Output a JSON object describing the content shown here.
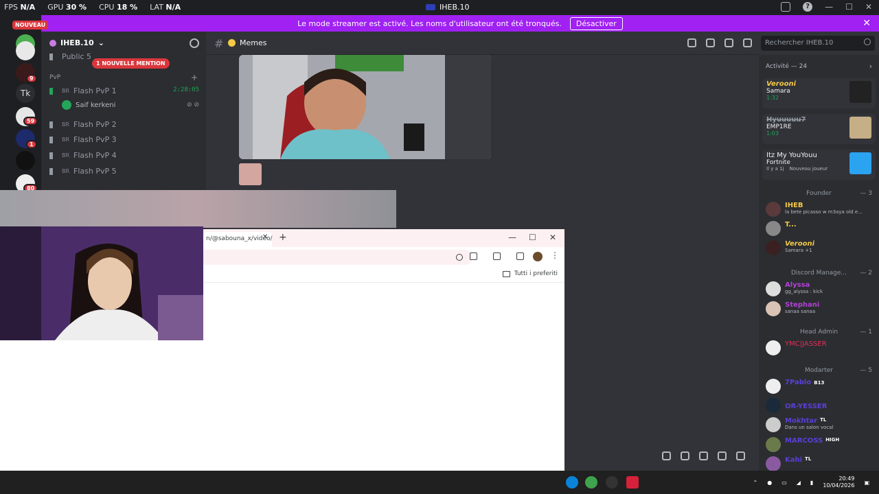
{
  "titlebar": {
    "fps_label": "FPS",
    "fps_value": "N/A",
    "gpu_label": "GPU",
    "gpu_value": "30 %",
    "cpu_label": "CPU",
    "cpu_value": "18 %",
    "lat_label": "LAT",
    "lat_value": "N/A",
    "app_title": "IHEB.10"
  },
  "banner": {
    "text": "Le mode streamer est activé. Les noms d'utilisateur ont été tronqués.",
    "button": "Désactiver"
  },
  "rail": {
    "new_badge": "NOUVEAU",
    "tk": "Tk",
    "badges": [
      "9",
      "59",
      "1",
      "80"
    ]
  },
  "sidebar": {
    "server_name": "IHEB.10",
    "mention_badge": "1 NOUVELLE MENTION",
    "top_channel": "Public 5",
    "category": "PvP",
    "channels": [
      {
        "tag": "BR",
        "name": "Flash PvP 1"
      },
      {
        "tag": "BR",
        "name": "Flash PvP 2"
      },
      {
        "tag": "BR",
        "name": "Flash PvP 3"
      },
      {
        "tag": "BR",
        "name": "Flash PvP 4"
      },
      {
        "tag": "BR",
        "name": "Flash PvP 5"
      }
    ],
    "timer": "2:28:05",
    "voice_user": "Saif kerkeni"
  },
  "channel": {
    "name": "Memes",
    "search_placeholder": "Rechercher IHEB.10"
  },
  "activity": {
    "title": "Activité — 24",
    "items": [
      {
        "name": "Verooni",
        "sub": "Samara",
        "time": "1:32"
      },
      {
        "name": "Hyuuuuu7",
        "sub": "EMP1RE",
        "time": "1:03"
      },
      {
        "name": "Itz My YouYouu",
        "sub": "Fortnite",
        "time": "Il y a 1j",
        "extra": "Nouveau joueur"
      }
    ]
  },
  "roles": [
    {
      "name": "Founder",
      "count": "— 3"
    },
    {
      "name": "Discord Manage...",
      "count": "— 2"
    },
    {
      "name": "Head Admin",
      "count": "— 1"
    },
    {
      "name": "Modarter",
      "count": "— 5"
    }
  ],
  "members": {
    "founder": [
      {
        "name": "IHEB",
        "sub": "la bete picasso w m3aya old e...",
        "color": "#f6c945"
      },
      {
        "name": "T...",
        "sub": "",
        "color": "#f6c945"
      },
      {
        "name": "Verooni",
        "sub": "Samara +1",
        "color": "#f6c945"
      }
    ],
    "manager": [
      {
        "name": "Alyssa",
        "sub": "gg_alyssa : kick",
        "color": "#b33fd6"
      },
      {
        "name": "Stephani",
        "sub": "sanaa sanaa",
        "color": "#b33fd6"
      }
    ],
    "admin": [
      {
        "name": "YMC|JASSER",
        "sub": "",
        "color": "#e52e59"
      }
    ],
    "mods": [
      {
        "name": "7Pablo",
        "tag": "B13",
        "sub": ""
      },
      {
        "name": "OR-YESSER",
        "tag": "",
        "sub": ""
      },
      {
        "name": "Mokhtar",
        "tag": "TL",
        "sub": "Dans un salon vocal"
      },
      {
        "name": "MARCOSS",
        "tag": "HIGH",
        "sub": ""
      },
      {
        "name": "Kahi",
        "tag": "TL",
        "sub": ""
      }
    ]
  },
  "browser": {
    "tab_title": "n/@sabouna_x/video/",
    "bookmarks": "Tutti i preferiti"
  },
  "taskbar": {
    "time": "20:49",
    "date": "10/04/2026"
  }
}
